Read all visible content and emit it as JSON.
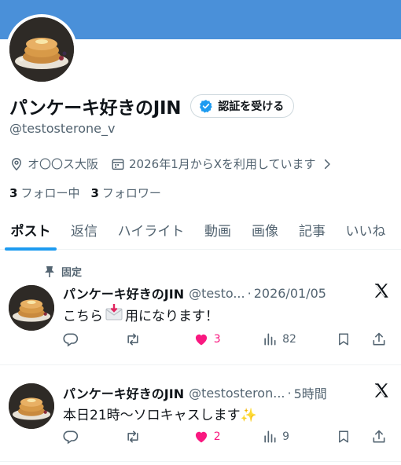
{
  "profile": {
    "display_name": "パンケーキ好きのJIN",
    "verify_label": "認証を受ける",
    "handle": "@testosterone_v",
    "location": "オ〇〇ス大阪",
    "joined": "2026年1月からXを利用しています",
    "following_count": "3",
    "following_label": "フォロー中",
    "followers_count": "3",
    "followers_label": "フォロワー"
  },
  "tabs": [
    "ポスト",
    "返信",
    "ハイライト",
    "動画",
    "画像",
    "記事",
    "いいね"
  ],
  "posts": [
    {
      "pinned_label": "固定",
      "name": "パンケーキ好きのJIN",
      "handle": "@testo...",
      "time": "2026/01/05",
      "text_before": "こちら",
      "text_after": "用になります！",
      "likes": "3",
      "views": "82"
    },
    {
      "name": "パンケーキ好きのJIN",
      "handle": "@testosteron...",
      "time": "5時間",
      "text": "本日21時〜ソロキャスします✨",
      "likes": "2",
      "views": "9"
    }
  ],
  "icons": {
    "verified": "verified-badge-icon",
    "location": "location-pin-icon",
    "calendar": "calendar-icon",
    "chevron": "chevron-right-icon",
    "pin": "pin-icon",
    "reply": "reply-icon",
    "repost": "repost-icon",
    "like": "heart-icon",
    "views": "views-icon",
    "bookmark": "bookmark-icon",
    "share": "share-icon",
    "x_logo": "x-logo-icon"
  },
  "colors": {
    "accent": "#1d9bf0",
    "like": "#f91880",
    "banner": "#4a90d9"
  }
}
